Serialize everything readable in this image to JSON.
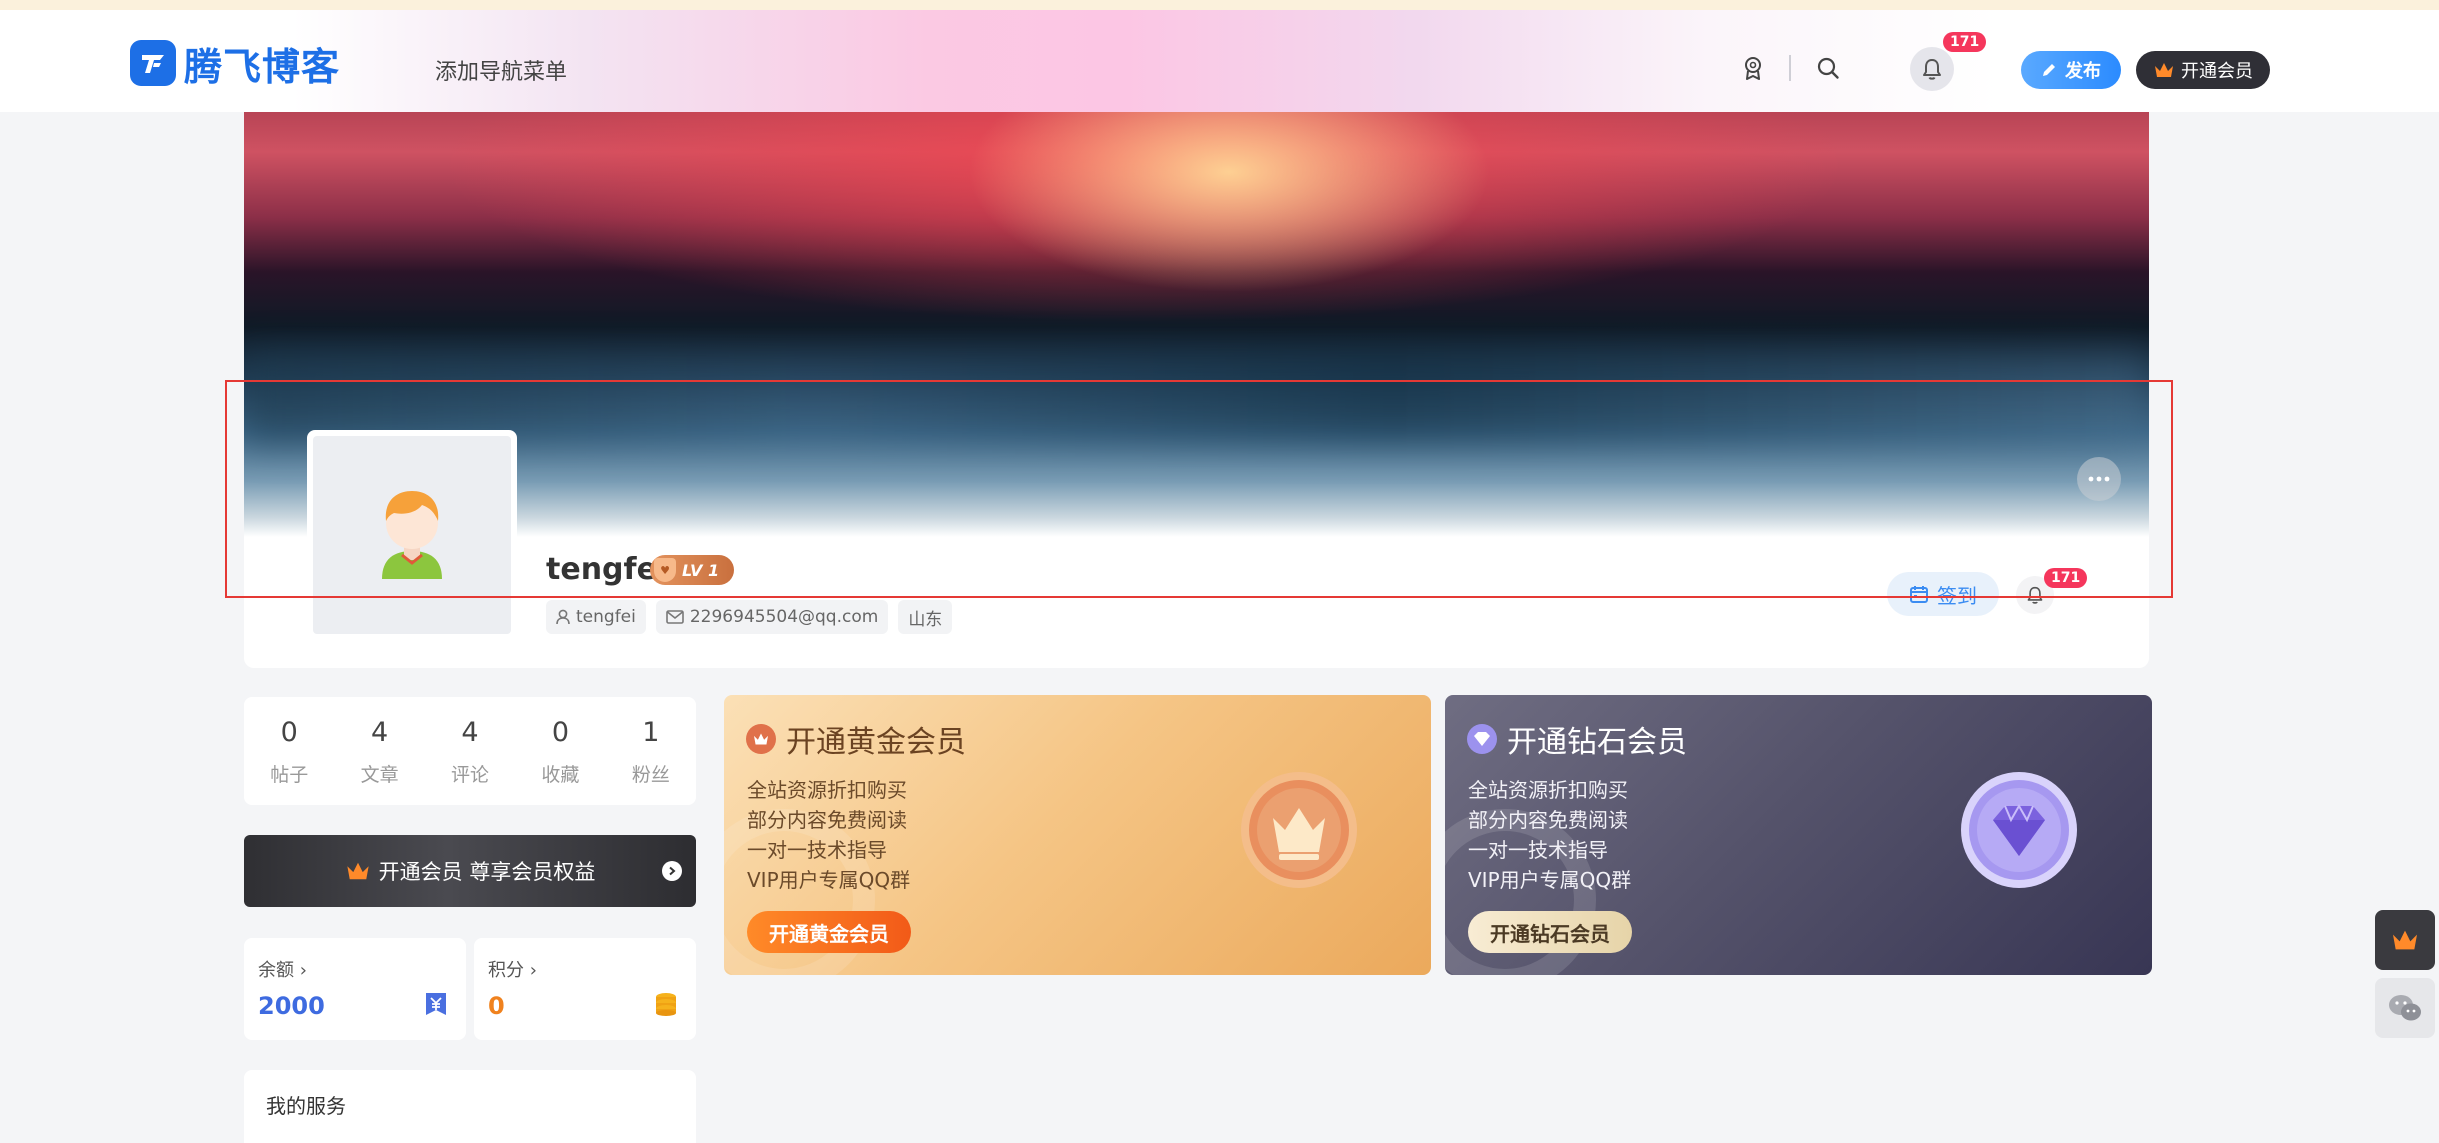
{
  "header": {
    "logo_text": "腾飞博客",
    "nav_item": "添加导航菜单",
    "notification_count": "171",
    "publish_label": "发布",
    "vip_label": "开通会员",
    "icons": [
      "award-icon",
      "search-icon",
      "bell-icon",
      "pencil-icon",
      "crown-icon"
    ]
  },
  "profile": {
    "username": "tengfei",
    "level": "LV 1",
    "tags": {
      "account": "tengfei",
      "email": "2296945504@qq.com",
      "location": "山东"
    },
    "checkin_label": "签到",
    "notification_count": "171"
  },
  "stats": [
    {
      "value": "0",
      "label": "帖子"
    },
    {
      "value": "4",
      "label": "文章"
    },
    {
      "value": "4",
      "label": "评论"
    },
    {
      "value": "0",
      "label": "收藏"
    },
    {
      "value": "1",
      "label": "粉丝"
    }
  ],
  "vip_banner": {
    "label": "开通会员 尊享会员权益"
  },
  "wallet": {
    "balance_label": "余额",
    "balance_value": "2000",
    "points_label": "积分",
    "points_value": "0",
    "chevron": "›"
  },
  "services": {
    "title": "我的服务"
  },
  "membership": {
    "gold": {
      "title": "开通黄金会员",
      "features": [
        "全站资源折扣购买",
        "部分内容免费阅读",
        "一对一技术指导",
        "VIP用户专属QQ群"
      ],
      "button": "开通黄金会员"
    },
    "diamond": {
      "title": "开通钻石会员",
      "features": [
        "全站资源折扣购买",
        "部分内容免费阅读",
        "一对一技术指导",
        "VIP用户专属QQ群"
      ],
      "button": "开通钻石会员"
    }
  },
  "colors": {
    "brand": "#1d6fe6",
    "publish": "#2b8bff",
    "badge": "#f5365c",
    "balance": "#3e6be0",
    "points": "#f0821e",
    "highlight_frame": "#e53935"
  }
}
